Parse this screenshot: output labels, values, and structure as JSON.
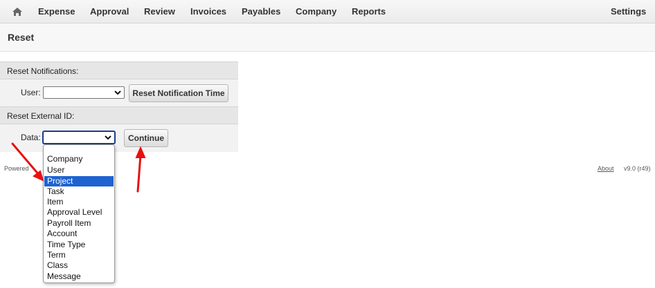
{
  "nav": {
    "items": [
      "Expense",
      "Approval",
      "Review",
      "Invoices",
      "Payables",
      "Company",
      "Reports"
    ],
    "settings": "Settings"
  },
  "page": {
    "title": "Reset"
  },
  "notifications": {
    "header": "Reset Notifications:",
    "user_label": "User:",
    "user_value": "",
    "button": "Reset Notification Time"
  },
  "external_id": {
    "header": "Reset External ID:",
    "data_label": "Data:",
    "data_value": "",
    "button": "Continue",
    "options": [
      "",
      "Company",
      "User",
      "Project",
      "Task",
      "Item",
      "Approval Level",
      "Payroll Item",
      "Account",
      "Time Type",
      "Term",
      "Class",
      "Message"
    ],
    "highlighted_option": "Project"
  },
  "footer": {
    "powered": "Powered",
    "about": "About",
    "version": "v9.0 (r49)"
  },
  "colors": {
    "highlight": "#1e63d0",
    "annotation_arrow": "#e81010"
  }
}
